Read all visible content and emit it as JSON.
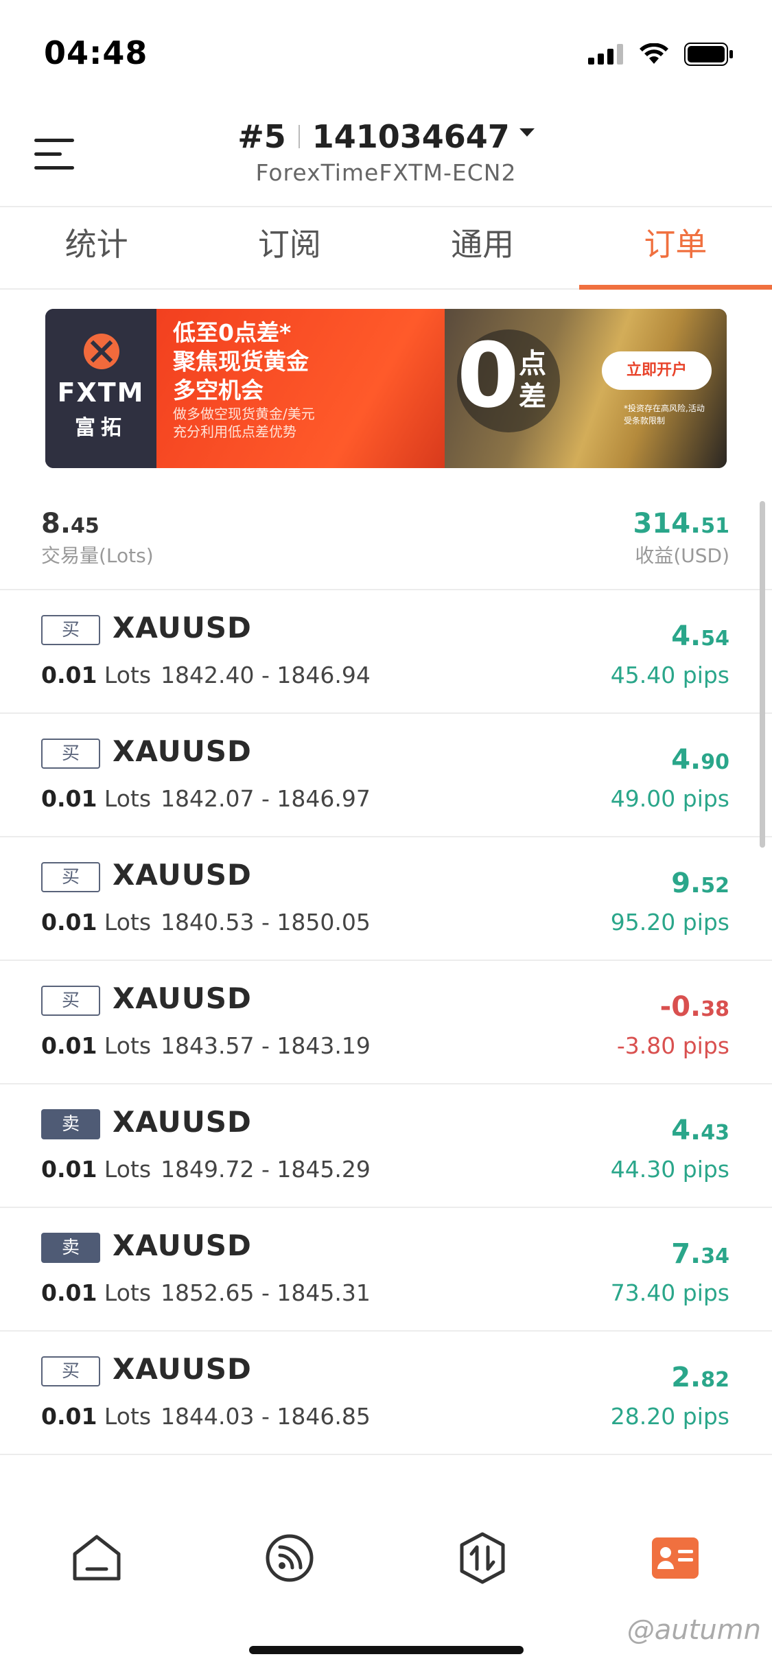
{
  "status_bar": {
    "time": "04:48"
  },
  "header": {
    "account_number": "#5",
    "account_id": "141034647",
    "server": "ForexTimeFXTM-ECN2"
  },
  "tabs": [
    {
      "label": "统计"
    },
    {
      "label": "订阅"
    },
    {
      "label": "通用"
    },
    {
      "label": "订单",
      "active": true
    }
  ],
  "banner": {
    "brand": "FXTM",
    "brand_cn": "富拓",
    "headline1": "低至0点差*",
    "headline2": "聚焦现货黄金",
    "headline3": "多空机会",
    "sub1": "做多做空现货黄金/美元",
    "sub2": "充分利用低点差优势",
    "zero": "0",
    "zero_label": "点差",
    "cta": "立即开户",
    "fine_print": "*投资存在高风险,活动受条款限制"
  },
  "summary": {
    "volume_int": "8.",
    "volume_dec": "45",
    "volume_label": "交易量(Lots)",
    "profit_int": "314.",
    "profit_dec": "51",
    "profit_label": "收益(USD)"
  },
  "orders": [
    {
      "side": "买",
      "type": "buy",
      "symbol": "XAUUSD",
      "lots": "0.01",
      "lots_unit": "Lots",
      "prices": "1842.40 - 1846.94",
      "profit_int": "4.",
      "profit_dec": "54",
      "pips": "45.40 pips",
      "positive": true
    },
    {
      "side": "买",
      "type": "buy",
      "symbol": "XAUUSD",
      "lots": "0.01",
      "lots_unit": "Lots",
      "prices": "1842.07 - 1846.97",
      "profit_int": "4.",
      "profit_dec": "90",
      "pips": "49.00 pips",
      "positive": true
    },
    {
      "side": "买",
      "type": "buy",
      "symbol": "XAUUSD",
      "lots": "0.01",
      "lots_unit": "Lots",
      "prices": "1840.53 - 1850.05",
      "profit_int": "9.",
      "profit_dec": "52",
      "pips": "95.20 pips",
      "positive": true
    },
    {
      "side": "买",
      "type": "buy",
      "symbol": "XAUUSD",
      "lots": "0.01",
      "lots_unit": "Lots",
      "prices": "1843.57 - 1843.19",
      "profit_int": "-0.",
      "profit_dec": "38",
      "pips": "-3.80 pips",
      "positive": false
    },
    {
      "side": "卖",
      "type": "sell",
      "symbol": "XAUUSD",
      "lots": "0.01",
      "lots_unit": "Lots",
      "prices": "1849.72 - 1845.29",
      "profit_int": "4.",
      "profit_dec": "43",
      "pips": "44.30 pips",
      "positive": true
    },
    {
      "side": "卖",
      "type": "sell",
      "symbol": "XAUUSD",
      "lots": "0.01",
      "lots_unit": "Lots",
      "prices": "1852.65 - 1845.31",
      "profit_int": "7.",
      "profit_dec": "34",
      "pips": "73.40 pips",
      "positive": true
    },
    {
      "side": "买",
      "type": "buy",
      "symbol": "XAUUSD",
      "lots": "0.01",
      "lots_unit": "Lots",
      "prices": "1844.03 - 1846.85",
      "profit_int": "2.",
      "profit_dec": "82",
      "pips": "28.20 pips",
      "positive": true
    }
  ],
  "bottom_nav": [
    {
      "icon": "home-icon"
    },
    {
      "icon": "signal-feed-icon"
    },
    {
      "icon": "trade-icon"
    },
    {
      "icon": "profile-card-icon",
      "active": true
    }
  ],
  "watermark": "@autumn",
  "colors": {
    "accent": "#f0703f",
    "profit": "#2aa68a",
    "loss": "#d9504f",
    "sell_badge": "#4f5b75"
  }
}
